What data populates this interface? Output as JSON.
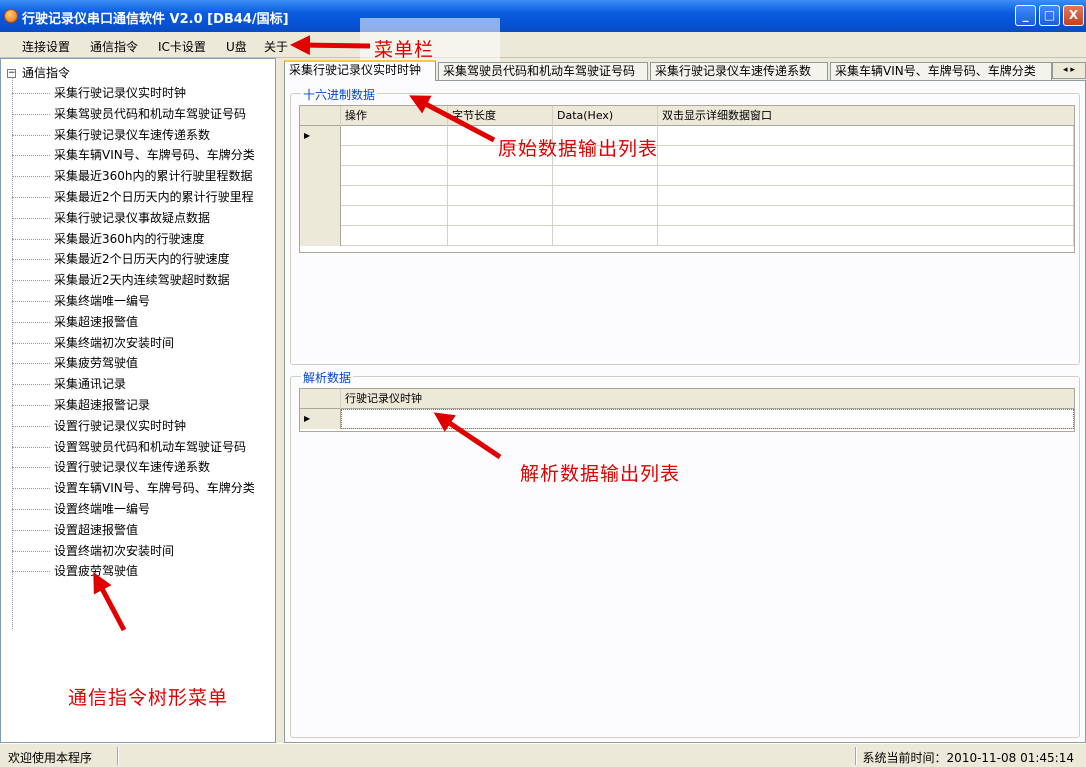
{
  "window": {
    "title": "行驶记录仪串口通信软件 V2.0 [DB44/国标]",
    "controls": [
      "_",
      "□",
      "X"
    ]
  },
  "menu": [
    "连接设置",
    "通信指令",
    "IC卡设置",
    "U盘",
    "关于"
  ],
  "tree": {
    "root": "通信指令",
    "expander": "⊟",
    "items": [
      "采集行驶记录仪实时时钟",
      "采集驾驶员代码和机动车驾驶证号码",
      "采集行驶记录仪车速传递系数",
      "采集车辆VIN号、车牌号码、车牌分类",
      "采集最近360h内的累计行驶里程数据",
      "采集最近2个日历天内的累计行驶里程",
      "采集行驶记录仪事故疑点数据",
      "采集最近360h内的行驶速度",
      "采集最近2个日历天内的行驶速度",
      "采集最近2天内连续驾驶超时数据",
      "采集终端唯一编号",
      "采集超速报警值",
      "采集终端初次安装时间",
      "采集疲劳驾驶值",
      "采集通讯记录",
      "采集超速报警记录",
      "设置行驶记录仪实时时钟",
      "设置驾驶员代码和机动车驾驶证号码",
      "设置行驶记录仪车速传递系数",
      "设置车辆VIN号、车牌号码、车牌分类",
      "设置终端唯一编号",
      "设置超速报警值",
      "设置终端初次安装时间",
      "设置疲劳驾驶值"
    ]
  },
  "tabs": [
    "采集行驶记录仪实时时钟",
    "采集驾驶员代码和机动车驾驶证号码",
    "采集行驶记录仪车速传递系数",
    "采集车辆VIN号、车牌号码、车牌分类"
  ],
  "tab_scroll": "◂ ▸",
  "hex_group": {
    "title": "十六进制数据",
    "columns": [
      "操作",
      "字节长度",
      "Data(Hex)",
      "双击显示详细数据窗口"
    ],
    "current_row_marker": "▶"
  },
  "parsed_group": {
    "title": "解析数据",
    "columns": [
      "行驶记录仪时钟"
    ],
    "current_row_marker": "▶"
  },
  "status": {
    "left": "欢迎使用本程序",
    "right": "系统当前时间：2010-11-08 01:45:14"
  },
  "annotations": {
    "menubar": "菜单栏",
    "raw_output": "原始数据输出列表",
    "parsed_output": "解析数据输出列表",
    "tree_menu": "通信指令树形菜单"
  },
  "colors": {
    "title_bar": "#0a5ce0",
    "group_title": "#0046d5",
    "annotation": "#e00000",
    "active_tab_accent": "#ffc83c"
  }
}
